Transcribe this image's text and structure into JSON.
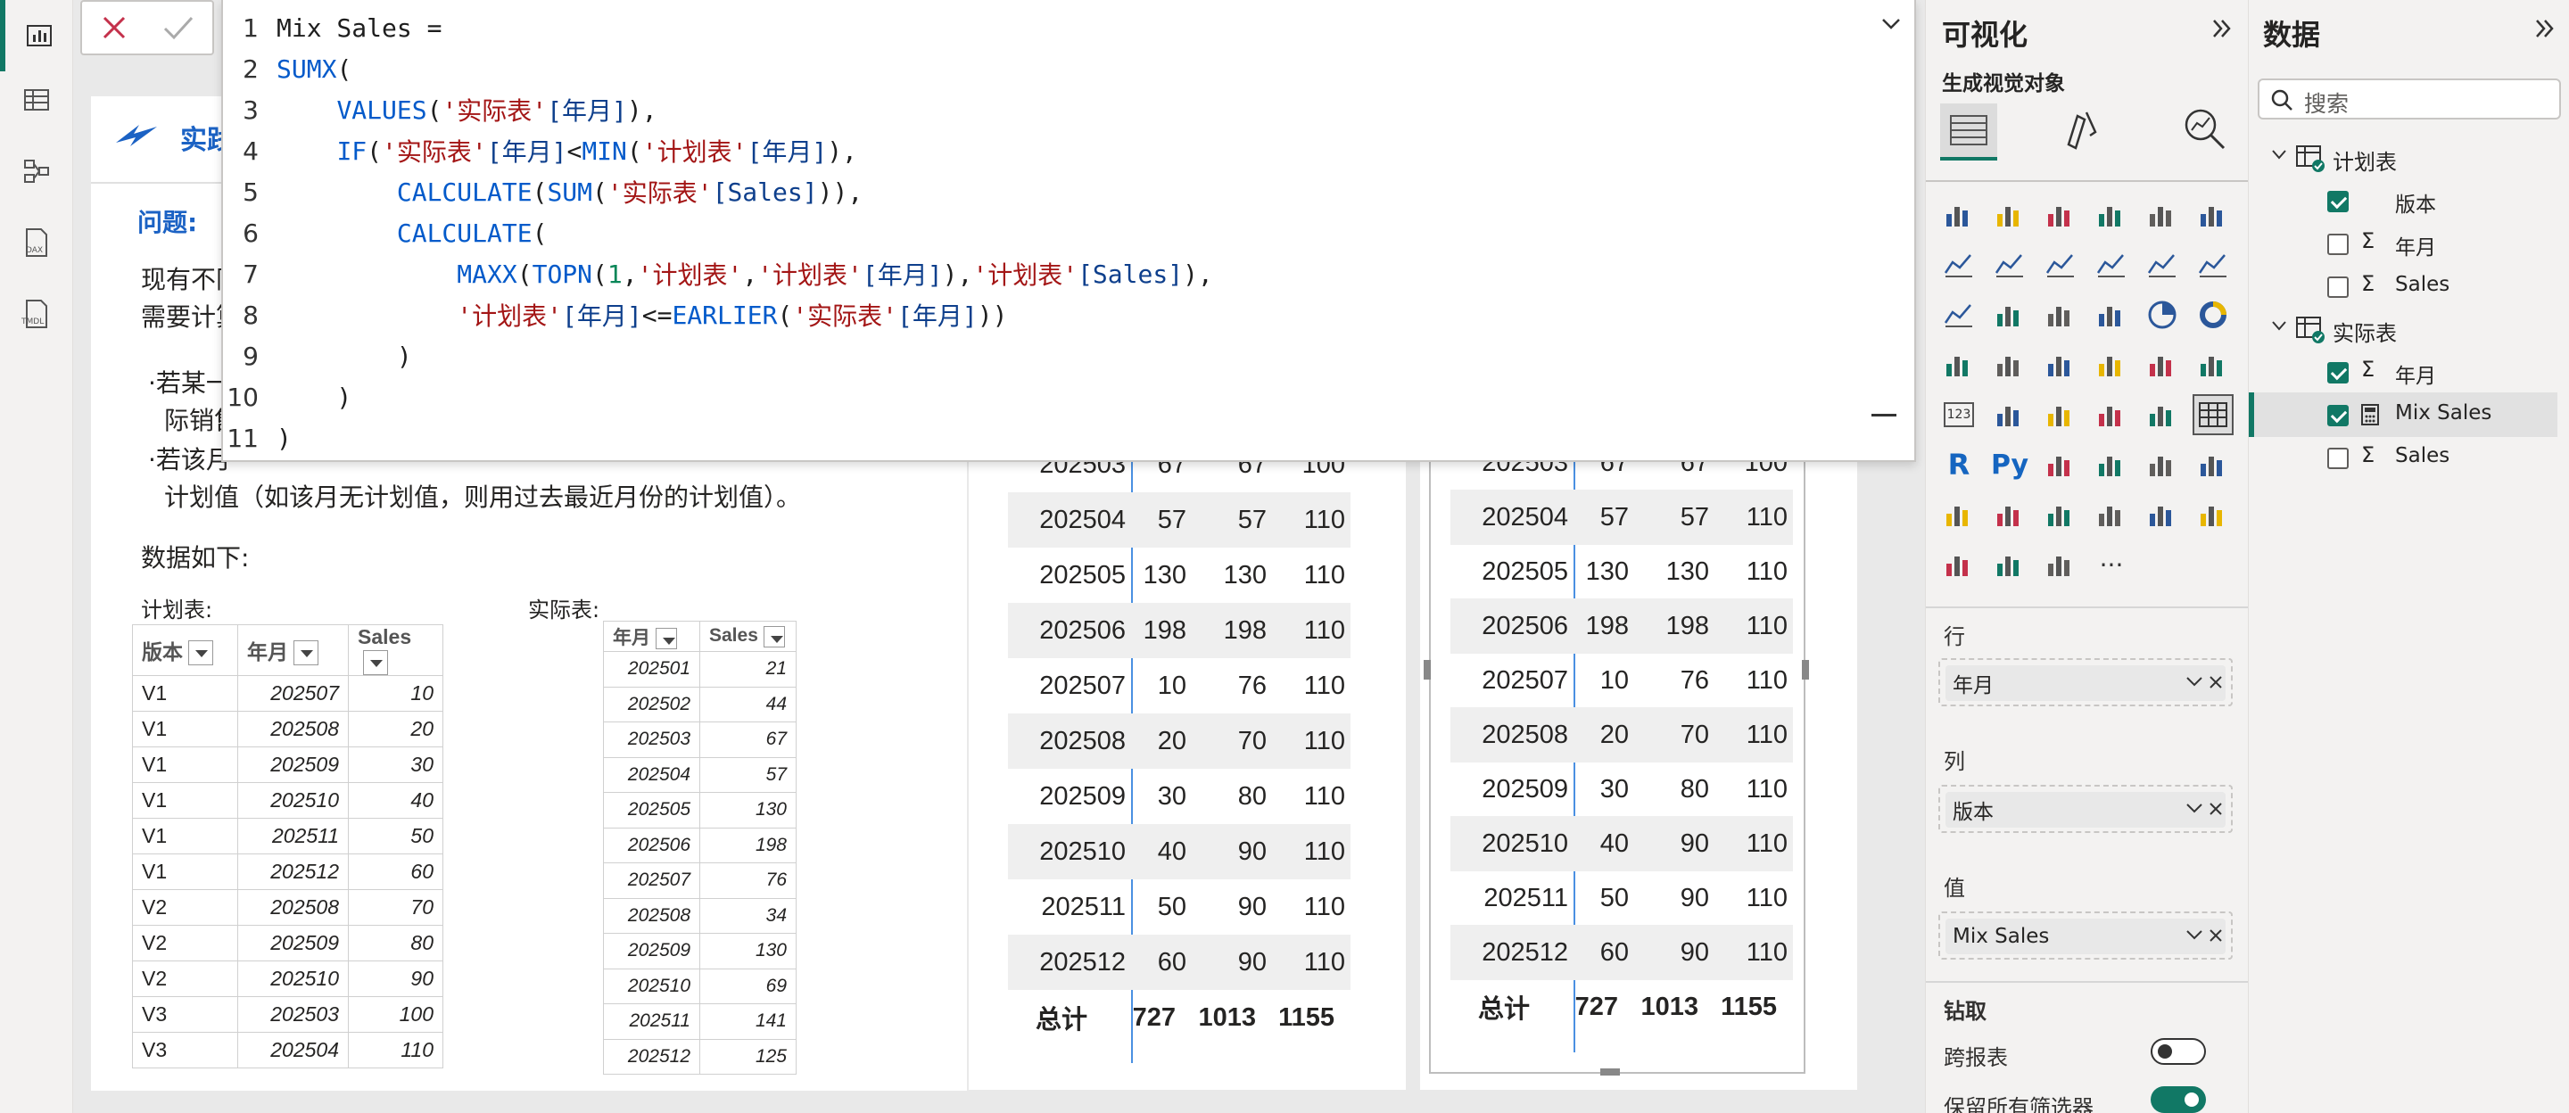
{
  "formula_bar": {
    "lines": [
      {
        "n": "1",
        "parts": [
          [
            "tx",
            "Mix Sales ="
          ]
        ]
      },
      {
        "n": "2",
        "parts": [
          [
            "kw",
            "SUMX"
          ],
          [
            "tx",
            "("
          ]
        ]
      },
      {
        "n": "3",
        "parts": [
          [
            "tx",
            "    "
          ],
          [
            "kw",
            "VALUES"
          ],
          [
            "tx",
            "("
          ],
          [
            "str",
            "'实际表'"
          ],
          [
            "col",
            "[年月]"
          ],
          [
            "tx",
            "),"
          ]
        ]
      },
      {
        "n": "4",
        "parts": [
          [
            "tx",
            "    "
          ],
          [
            "kw",
            "IF"
          ],
          [
            "tx",
            "("
          ],
          [
            "str",
            "'实际表'"
          ],
          [
            "col",
            "[年月]"
          ],
          [
            "tx",
            "<"
          ],
          [
            "kw",
            "MIN"
          ],
          [
            "tx",
            "("
          ],
          [
            "str",
            "'计划表'"
          ],
          [
            "col",
            "[年月]"
          ],
          [
            "tx",
            "),"
          ]
        ]
      },
      {
        "n": "5",
        "parts": [
          [
            "tx",
            "        "
          ],
          [
            "kw",
            "CALCULATE"
          ],
          [
            "tx",
            "("
          ],
          [
            "kw",
            "SUM"
          ],
          [
            "tx",
            "("
          ],
          [
            "str",
            "'实际表'"
          ],
          [
            "col",
            "[Sales]"
          ],
          [
            "tx",
            ")),"
          ]
        ]
      },
      {
        "n": "6",
        "parts": [
          [
            "tx",
            "        "
          ],
          [
            "kw",
            "CALCULATE"
          ],
          [
            "tx",
            "("
          ]
        ]
      },
      {
        "n": "7",
        "parts": [
          [
            "tx",
            "            "
          ],
          [
            "kw",
            "MAXX"
          ],
          [
            "tx",
            "("
          ],
          [
            "kw",
            "TOPN"
          ],
          [
            "tx",
            "("
          ],
          [
            "num",
            "1"
          ],
          [
            "tx",
            ","
          ],
          [
            "str",
            "'计划表'"
          ],
          [
            "tx",
            ","
          ],
          [
            "str",
            "'计划表'"
          ],
          [
            "col",
            "[年月]"
          ],
          [
            "tx",
            "),"
          ],
          [
            "str",
            "'计划表'"
          ],
          [
            "col",
            "[Sales]"
          ],
          [
            "tx",
            "),"
          ]
        ]
      },
      {
        "n": "8",
        "parts": [
          [
            "tx",
            "            "
          ],
          [
            "str",
            "'计划表'"
          ],
          [
            "col",
            "[年月]"
          ],
          [
            "tx",
            "<="
          ],
          [
            "kw",
            "EARLIER"
          ],
          [
            "tx",
            "("
          ],
          [
            "str",
            "'实际表'"
          ],
          [
            "col",
            "[年月]"
          ],
          [
            "tx",
            "))"
          ]
        ]
      },
      {
        "n": "9",
        "parts": [
          [
            "tx",
            "        )"
          ]
        ]
      },
      {
        "n": "10",
        "parts": [
          [
            "tx",
            "    )"
          ]
        ]
      },
      {
        "n": "11",
        "parts": [
          [
            "tx",
            ")"
          ]
        ]
      }
    ]
  },
  "card": {
    "title": "实践案",
    "question_label": "问题:",
    "desc1": "现有不同",
    "desc2": "需要计算",
    "bullet1a": "·若某一",
    "bullet1b": "际销售",
    "bullet2a": "·若该月",
    "bullet2b": "计划值（如该月无计划值，则用过去最近月份的计划值）。",
    "data_intro": "数据如下:",
    "plan_label": "计划表:",
    "actual_label": "实际表:",
    "plan_headers": [
      "版本",
      "年月",
      "Sales"
    ],
    "plan_rows": [
      [
        "V1",
        "202507",
        "10"
      ],
      [
        "V1",
        "202508",
        "20"
      ],
      [
        "V1",
        "202509",
        "30"
      ],
      [
        "V1",
        "202510",
        "40"
      ],
      [
        "V1",
        "202511",
        "50"
      ],
      [
        "V1",
        "202512",
        "60"
      ],
      [
        "V2",
        "202508",
        "70"
      ],
      [
        "V2",
        "202509",
        "80"
      ],
      [
        "V2",
        "202510",
        "90"
      ],
      [
        "V3",
        "202503",
        "100"
      ],
      [
        "V3",
        "202504",
        "110"
      ]
    ],
    "actual_headers": [
      "年月",
      "Sales"
    ],
    "actual_rows": [
      [
        "202501",
        "21"
      ],
      [
        "202502",
        "44"
      ],
      [
        "202503",
        "67"
      ],
      [
        "202504",
        "57"
      ],
      [
        "202505",
        "130"
      ],
      [
        "202506",
        "198"
      ],
      [
        "202507",
        "76"
      ],
      [
        "202508",
        "34"
      ],
      [
        "202509",
        "130"
      ],
      [
        "202510",
        "69"
      ],
      [
        "202511",
        "141"
      ],
      [
        "202512",
        "125"
      ]
    ]
  },
  "matrix": {
    "rows": [
      [
        "202503",
        "67",
        "67",
        "100"
      ],
      [
        "202504",
        "57",
        "57",
        "110"
      ],
      [
        "202505",
        "130",
        "130",
        "110"
      ],
      [
        "202506",
        "198",
        "198",
        "110"
      ],
      [
        "202507",
        "10",
        "76",
        "110"
      ],
      [
        "202508",
        "20",
        "70",
        "110"
      ],
      [
        "202509",
        "30",
        "80",
        "110"
      ],
      [
        "202510",
        "40",
        "90",
        "110"
      ],
      [
        "202511",
        "50",
        "90",
        "110"
      ],
      [
        "202512",
        "60",
        "90",
        "110"
      ]
    ],
    "total": [
      "总计",
      "727",
      "1013",
      "1155"
    ]
  },
  "viz_pane": {
    "title": "可视化",
    "subtitle": "生成视觉对象",
    "rows_label": "行",
    "rows_field": "年月",
    "cols_label": "列",
    "cols_field": "版本",
    "values_label": "值",
    "values_field": "Mix Sales",
    "drill_label": "钻取",
    "cross_report": "跨报表",
    "keep_filters": "保留所有筛选器",
    "more": "···",
    "r_label": "R",
    "py_label": "Py",
    "num_label": "123"
  },
  "data_pane": {
    "title": "数据",
    "search_placeholder": "搜索",
    "table1": "计划表",
    "t1_fields": [
      "版本",
      "年月",
      "Sales"
    ],
    "table2": "实际表",
    "t2_fields": [
      "年月",
      "Mix Sales",
      "Sales"
    ]
  },
  "colors": {
    "accent": "#117865",
    "keyword": "#035aca",
    "string": "#a31515"
  }
}
